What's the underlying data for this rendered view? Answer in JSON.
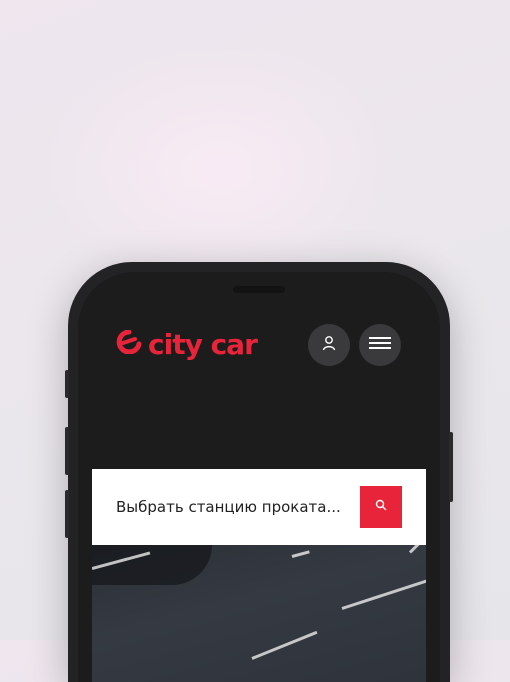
{
  "brand": {
    "name": "city car",
    "color": "#e8243a"
  },
  "header": {
    "account_icon": "user-icon",
    "menu_icon": "hamburger-menu-icon"
  },
  "search": {
    "placeholder": "Выбрать станцию проката...",
    "button_icon": "search-icon"
  }
}
